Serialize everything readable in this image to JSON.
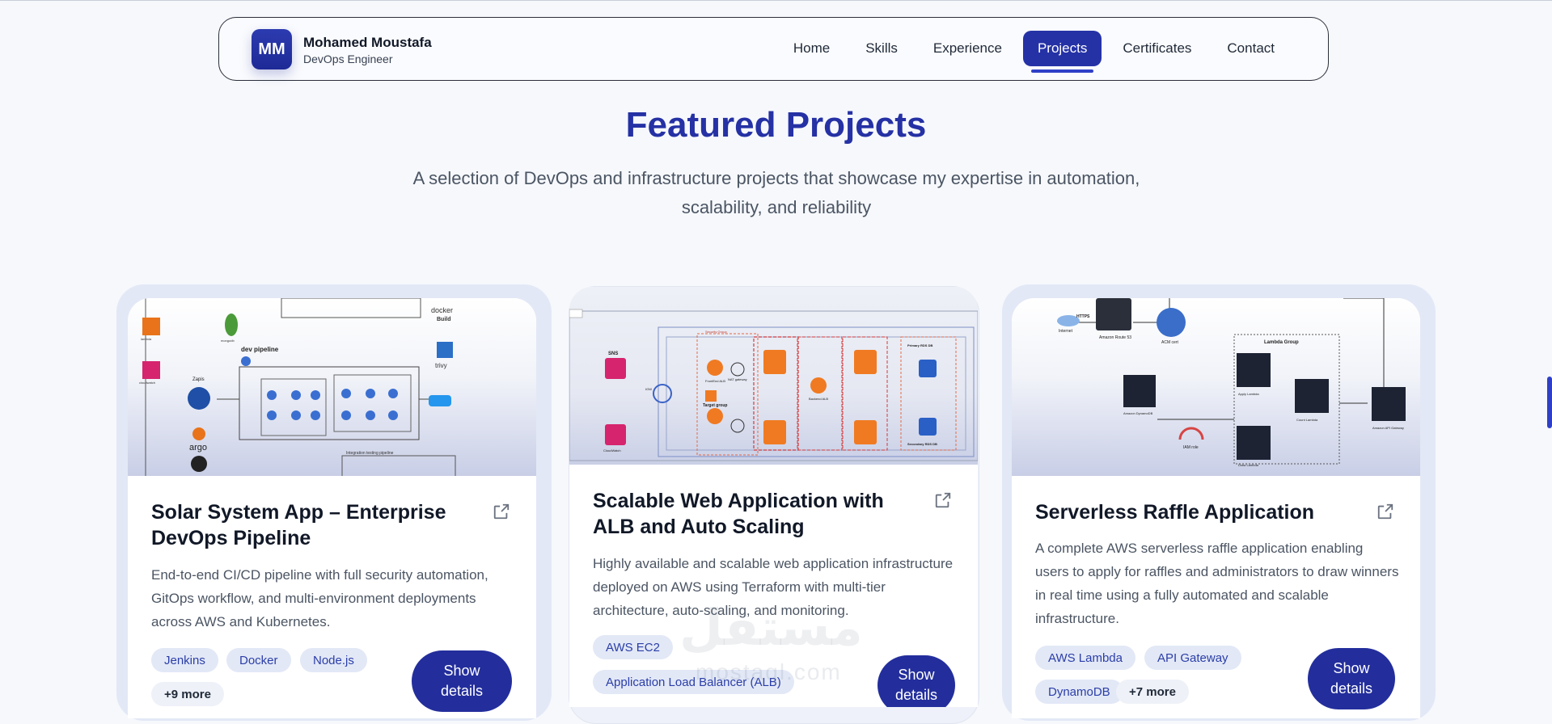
{
  "nav": {
    "logo_text": "MM",
    "name": "Mohamed Moustafa",
    "role": "DevOps Engineer",
    "links": [
      "Home",
      "Skills",
      "Experience",
      "Projects",
      "Certificates",
      "Contact"
    ],
    "active": "Projects"
  },
  "section": {
    "title": "Featured Projects",
    "subtitle": "A selection of DevOps and infrastructure projects that showcase my expertise in automation, scalability, and reliability"
  },
  "projects": [
    {
      "title": "Solar System App – Enterprise DevOps Pipeline",
      "description": "End-to-end CI/CD pipeline with full security automation, GitOps workflow, and multi-environment deployments across AWS and Kubernetes.",
      "tags": [
        "Jenkins",
        "Docker",
        "Node.js"
      ],
      "more": "+9 more",
      "button": "Show details",
      "diagram_labels": [
        "dev pipeline",
        "Zapis",
        "argo",
        "docker",
        "Build",
        "trivy",
        "Integration testing pipeline",
        "mongodb",
        "lambda",
        "cloudwatch"
      ]
    },
    {
      "title": "Scalable Web Application with ALB and Auto Scaling",
      "description": "Highly available and scalable web application infrastructure deployed on AWS using Terraform with multi-tier architecture, auto-scaling, and monitoring.",
      "tags": [
        "AWS EC2",
        "Application Load Balancer (ALB)"
      ],
      "more": "",
      "button": "Show details",
      "diagram_labels": [
        "SNS",
        "IGW",
        "Target group",
        "Security Group",
        "Primary RDS DB",
        "Secondary RDS DB",
        "CloudWatch",
        "FrontEnd ALB",
        "Backend ALB",
        "NAT gateway"
      ]
    },
    {
      "title": "Serverless Raffle Application",
      "description": "A complete AWS serverless raffle application enabling users to apply for raffles and administrators to draw winners in real time using a fully automated and scalable infrastructure.",
      "tags": [
        "AWS Lambda",
        "API Gateway",
        "DynamoDB"
      ],
      "more": "+7 more",
      "button": "Show details",
      "diagram_labels": [
        "Internet",
        "HTTPS",
        "Amazon Route 53",
        "ACM cert",
        "Lambda Group",
        "Apply Lambda",
        "Count Lambda",
        "Draw Lambda",
        "Amazon DynamoDB",
        "IAM role",
        "Amazon API Gateway"
      ]
    }
  ],
  "watermark": {
    "arabic": "مستقل",
    "latin": "mostaql.com"
  },
  "colors": {
    "primary": "#2532a6",
    "title": "#2531a4",
    "tag_bg": "#e2e8f6"
  }
}
